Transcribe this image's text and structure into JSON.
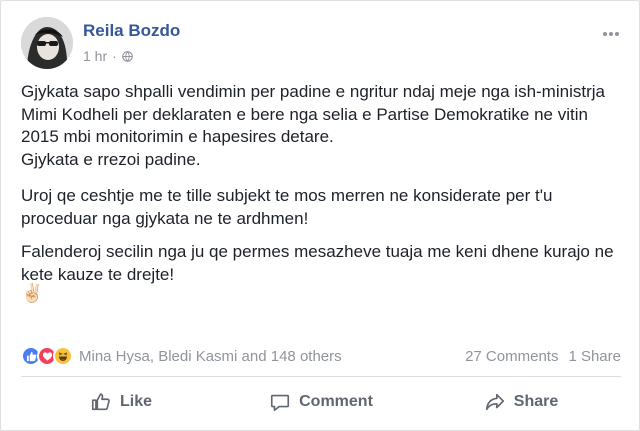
{
  "post": {
    "author": "Reila Bozdo",
    "time": "1 hr",
    "separator": "·",
    "paragraphs": {
      "p1": "Gjykata sapo shpalli vendimin per padine e ngritur ndaj meje nga ish-ministrja Mimi Kodheli per deklaraten e bere nga selia e Partise Demokratike ne vitin 2015 mbi monitorimin e hapesires detare.",
      "p1b": "Gjykata e rrezoi padine.",
      "p2": "Uroj qe ceshtje me te tille subjekt te mos merren ne konsiderate per t'u proceduar nga gjykata ne te ardhmen!",
      "p3": "Falenderoj secilin nga ju qe permes mesazheve tuaja me keni dhene kurajo ne kete kauze te drejte!",
      "emoji": "✌🏻"
    }
  },
  "engagement": {
    "reactions_text": "Mina Hysa, Bledi Kasmi and 148 others",
    "comments": "27 Comments",
    "shares": "1 Share",
    "reaction_icons": [
      "like-icon",
      "love-icon",
      "haha-icon"
    ],
    "colors": {
      "like": "#4a7cf4",
      "love": "#f0405c",
      "haha": "#f7c33d"
    }
  },
  "actions": {
    "like": "Like",
    "comment": "Comment",
    "share": "Share"
  },
  "colors": {
    "author": "#365899",
    "meta": "#90949c",
    "action_text": "#606770"
  }
}
